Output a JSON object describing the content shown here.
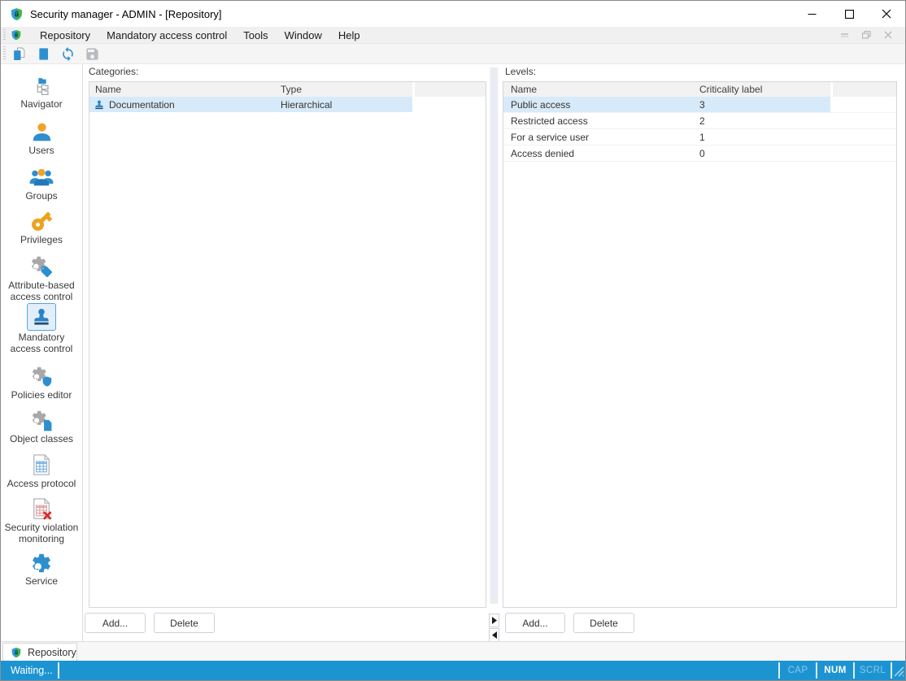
{
  "colors": {
    "status_bar_blue": "#1d94d2",
    "selection_blue": "#d7eaf9",
    "sidebar_selected_bg": "#e2effb",
    "sidebar_selected_border": "#54a5de",
    "icon_blue": "#2e8fd0",
    "icon_orange": "#f0a32a",
    "icon_gold": "#eba21f",
    "icon_gray": "#a8a8a8",
    "shield_green": "#3cb54a",
    "violation_red": "#d92b2b"
  },
  "titlebar": {
    "icon": "app-shield-icon",
    "title": "Security manager - ADMIN - [Repository]",
    "controls": [
      "minimize-icon",
      "maximize-icon",
      "close-icon"
    ]
  },
  "menubar": {
    "icon": "app-shield-icon",
    "items": [
      {
        "label": "Repository"
      },
      {
        "label": "Mandatory access control"
      },
      {
        "label": "Tools"
      },
      {
        "label": "Window"
      },
      {
        "label": "Help"
      }
    ],
    "mdi_controls": [
      "mdi-minimize-icon",
      "mdi-restore-icon",
      "mdi-close-icon"
    ]
  },
  "toolbar": {
    "buttons": [
      {
        "icon": "copy-document-icon",
        "enabled": true
      },
      {
        "icon": "document-icon",
        "enabled": true
      },
      {
        "icon": "refresh-icon",
        "enabled": true
      },
      {
        "icon": "save-icon",
        "enabled": false
      }
    ]
  },
  "sidebar": {
    "items": [
      {
        "label": "Navigator",
        "icon": "navigator-tree-icon",
        "selected": false
      },
      {
        "label": "Users",
        "icon": "user-icon",
        "selected": false
      },
      {
        "label": "Groups",
        "icon": "groups-icon",
        "selected": false
      },
      {
        "label": "Privileges",
        "icon": "key-icon",
        "selected": false
      },
      {
        "label": "Attribute-based access control",
        "icon": "gear-tag-icon",
        "selected": false
      },
      {
        "label": "Mandatory access control",
        "icon": "stamp-icon",
        "selected": true
      },
      {
        "label": "Policies editor",
        "icon": "gear-shield-icon",
        "selected": false
      },
      {
        "label": "Object classes",
        "icon": "gear-document-icon",
        "selected": false
      },
      {
        "label": "Access protocol",
        "icon": "table-document-icon",
        "selected": false
      },
      {
        "label": "Security violation monitoring",
        "icon": "table-error-icon",
        "selected": false
      },
      {
        "label": "Service",
        "icon": "gear-icon",
        "selected": false
      }
    ]
  },
  "categories": {
    "label": "Categories:",
    "table": {
      "headers": [
        "Name",
        "Type"
      ],
      "rows": [
        {
          "icon": "stamp-icon",
          "name": "Documentation",
          "type": "Hierarchical",
          "selected": true
        }
      ]
    },
    "buttons": {
      "add": "Add...",
      "delete": "Delete"
    }
  },
  "levels": {
    "label": "Levels:",
    "table": {
      "headers": [
        "Name",
        "Criticality label"
      ],
      "rows": [
        {
          "name": "Public access",
          "criticality": "3",
          "selected": true
        },
        {
          "name": "Restricted access",
          "criticality": "2",
          "selected": false
        },
        {
          "name": "For a service user",
          "criticality": "1",
          "selected": false
        },
        {
          "name": "Access denied",
          "criticality": "0",
          "selected": false
        }
      ]
    },
    "buttons": {
      "add": "Add...",
      "delete": "Delete"
    }
  },
  "tabbar": {
    "tabs": [
      {
        "label": "Repository",
        "icon": "app-shield-icon",
        "active": true
      }
    ]
  },
  "statusbar": {
    "message": "Waiting...",
    "indicators": [
      {
        "label": "CAP",
        "active": false
      },
      {
        "label": "NUM",
        "active": true
      },
      {
        "label": "SCRL",
        "active": false
      }
    ]
  }
}
